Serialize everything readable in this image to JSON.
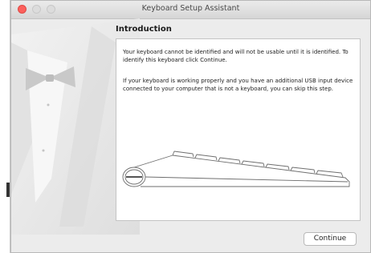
{
  "window": {
    "title": "Keyboard Setup Assistant"
  },
  "section": {
    "heading": "Introduction"
  },
  "content": {
    "paragraph1": "Your keyboard cannot be identified and will not be usable until it is identified. To identify this keyboard click Continue.",
    "paragraph2": "If your keyboard is working properly and you have an additional USB input device connected to your computer that is not a keyboard, you can skip this step."
  },
  "buttons": {
    "continue_label": "Continue"
  },
  "colors": {
    "close_light": "#fc605c",
    "window_bg": "#ececec"
  },
  "icons": {
    "illustration": "tuxedo-bowtie",
    "device": "keyboard-outline"
  }
}
